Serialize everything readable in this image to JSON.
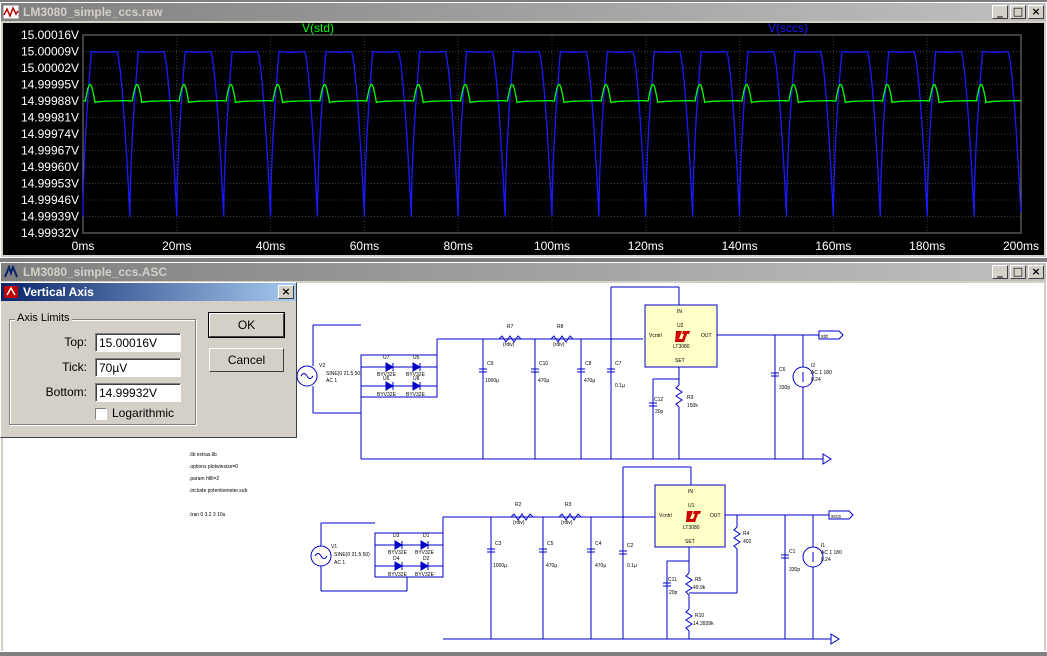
{
  "plot_window": {
    "title": "LM3080_simple_ccs.raw",
    "trace1_name": "V(std)",
    "trace2_name": "V(sccs)",
    "y_ticks": [
      "15.00016V",
      "15.00009V",
      "15.00002V",
      "14.99995V",
      "14.99988V",
      "14.99981V",
      "14.99974V",
      "14.99967V",
      "14.99960V",
      "14.99953V",
      "14.99946V",
      "14.99939V",
      "14.99932V"
    ],
    "x_ticks": [
      "0ms",
      "20ms",
      "40ms",
      "60ms",
      "80ms",
      "100ms",
      "120ms",
      "140ms",
      "160ms",
      "180ms",
      "200ms"
    ],
    "colors": {
      "trace1": "#00ff00",
      "trace2": "#1a1aff",
      "grid": "#3c3c3c",
      "axis_text": "#ffffff"
    }
  },
  "schematic_window": {
    "title": "LM3080_simple_ccs.ASC",
    "directives": [
      ".lib extras.lib",
      ".options plotwinsize=0",
      ".param hfill=2",
      ".include potentiometer.sub",
      ".tran 0 3.2 3 10u"
    ],
    "top": {
      "source_name": "V2",
      "source_value": "SINE(0 21.5 50)",
      "source_ac": "AC 1",
      "diodes": [
        {
          "name": "U7",
          "type": "BYV32E"
        },
        {
          "name": "U5",
          "type": "BYV32E"
        },
        {
          "name": "U6",
          "type": "BYV32E"
        },
        {
          "name": "U8",
          "type": "BYV32E"
        }
      ],
      "r_left": {
        "name": "R7",
        "value": "{rdiv}"
      },
      "r_right": {
        "name": "R8",
        "value": "{rdiv}"
      },
      "caps": [
        {
          "name": "C9",
          "value": "1000µ"
        },
        {
          "name": "C10",
          "value": "470µ"
        },
        {
          "name": "C8",
          "value": "470µ"
        },
        {
          "name": "C7",
          "value": "0.1µ"
        },
        {
          "name": "C12",
          "value": "20p"
        },
        {
          "name": "C6",
          "value": "330p"
        }
      ],
      "ic": {
        "pin_in": "IN",
        "name": "U2",
        "part": "LT3080",
        "pin_ctrl": "Vcntrl",
        "pin_out": "OUT",
        "pin_set": "SET"
      },
      "r_set": {
        "name": "R9",
        "value": "150k"
      },
      "load": {
        "name": "I2",
        "value": "AC 1 180",
        "value2": "0.24"
      },
      "net_label": "std"
    },
    "bottom": {
      "source_name": "V1",
      "source_value": "SINE(0 21.5 50)",
      "source_ac": "AC 1",
      "diodes": [
        {
          "name": "D3",
          "type": "BYV32E"
        },
        {
          "name": "D1",
          "type": "BYV32E"
        },
        {
          "name": "D4",
          "type": "BYV32E"
        },
        {
          "name": "D2",
          "type": "BYV32E"
        }
      ],
      "r_left": {
        "name": "R2",
        "value": "{rdiv}"
      },
      "r_right": {
        "name": "R3",
        "value": "{rdiv}"
      },
      "caps": [
        {
          "name": "C3",
          "value": "1000µ"
        },
        {
          "name": "C5",
          "value": "470µ"
        },
        {
          "name": "C4",
          "value": "470µ"
        },
        {
          "name": "C2",
          "value": "0.1µ"
        },
        {
          "name": "C11",
          "value": "20p"
        },
        {
          "name": "C1",
          "value": "330p"
        }
      ],
      "ic": {
        "pin_in": "IN",
        "name": "U1",
        "part": "LT3080",
        "pin_ctrl": "Vcntrl",
        "pin_out": "OUT",
        "pin_set": "SET"
      },
      "r_out": {
        "name": "R4",
        "value": "402"
      },
      "r_set": {
        "name": "R5",
        "value": "49.9k"
      },
      "r_set2": {
        "name": "R10",
        "value": "14.3939k"
      },
      "load": {
        "name": "I1",
        "value": "AC 1 180",
        "value2": "0.24"
      },
      "net_label": "sccs"
    }
  },
  "dialog": {
    "title": "Vertical Axis",
    "group_label": "Axis Limits",
    "top_label": "Top:",
    "top_value": "15.00016V",
    "tick_label": "Tick:",
    "tick_value": "70µV",
    "bottom_label": "Bottom:",
    "bottom_value": "14.99932V",
    "log_label": "Logarithmic",
    "ok_label": "OK",
    "cancel_label": "Cancel"
  },
  "chart_data": {
    "type": "line",
    "xlabel": "",
    "ylabel": "",
    "xlim": [
      0,
      200
    ],
    "ylim": [
      14.99932,
      15.00016
    ],
    "x_unit": "ms",
    "grid": true,
    "period_ms": 10,
    "series": [
      {
        "name": "V(std)",
        "shape": "periodic",
        "baseline": 14.99988,
        "peak": 14.99995
      },
      {
        "name": "V(sccs)",
        "shape": "periodic",
        "high": 15.00009,
        "low": 14.99939
      }
    ]
  }
}
